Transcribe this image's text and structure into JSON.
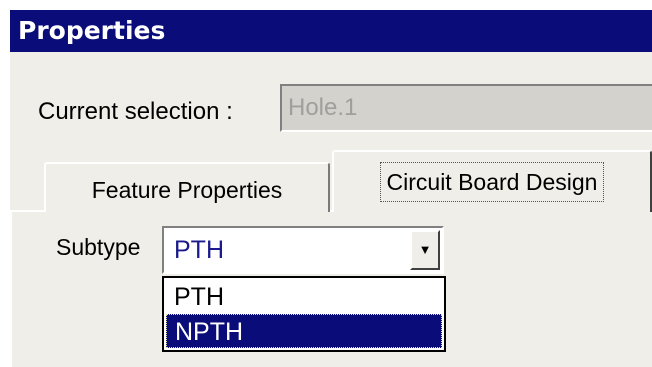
{
  "window": {
    "title": "Properties"
  },
  "selection": {
    "label": "Current selection :",
    "value": "Hole.1"
  },
  "tabs": [
    {
      "label": "Feature Properties",
      "active": false
    },
    {
      "label": "Circuit Board Design",
      "active": true
    }
  ],
  "subtype": {
    "label": "Subtype",
    "value": "PTH",
    "options": [
      "PTH",
      "NPTH"
    ],
    "highlighted": "NPTH",
    "arrow_icon": "chevron-down-icon"
  },
  "colors": {
    "titlebar": "#0a0c7a",
    "dialog_bg": "#efeee8",
    "highlight": "#0a0c7a",
    "combo_text": "#1a1a8c",
    "disabled_text": "#a09f9b"
  }
}
